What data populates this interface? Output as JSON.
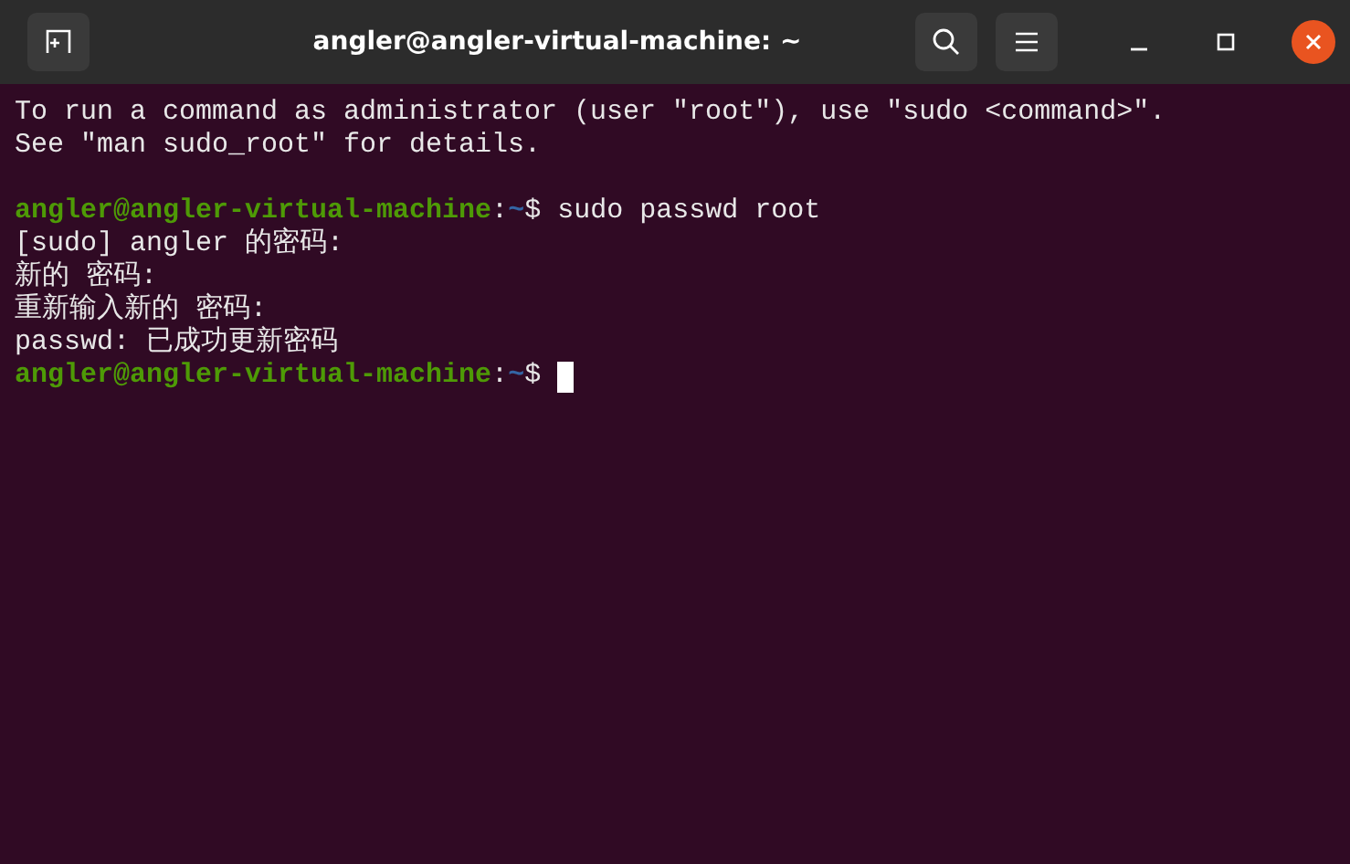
{
  "window": {
    "title": "angler@angler-virtual-machine: ~",
    "buttons": [
      {
        "kind": "new-tab"
      },
      {
        "kind": "search"
      },
      {
        "kind": "menu"
      },
      {
        "kind": "minimize"
      },
      {
        "kind": "maximize"
      },
      {
        "kind": "close"
      }
    ]
  },
  "terminal": {
    "lines": [
      {
        "kind": "output",
        "segments": [
          {
            "kind": "text",
            "text": "To run a command as administrator (user \"root\"), use \"sudo <command>\"."
          }
        ]
      },
      {
        "kind": "output",
        "segments": [
          {
            "kind": "text",
            "text": "See \"man sudo_root\" for details."
          }
        ]
      },
      {
        "kind": "blank"
      },
      {
        "kind": "output",
        "segments": [
          {
            "kind": "user",
            "text": "angler@angler-virtual-machine"
          },
          {
            "kind": "text",
            "text": ":"
          },
          {
            "kind": "path",
            "text": "~"
          },
          {
            "kind": "text",
            "text": "$ sudo passwd root"
          }
        ]
      },
      {
        "kind": "output",
        "segments": [
          {
            "kind": "text",
            "text": "[sudo] angler 的密码:"
          }
        ]
      },
      {
        "kind": "output",
        "segments": [
          {
            "kind": "text",
            "text": "新的 密码:"
          }
        ]
      },
      {
        "kind": "output",
        "segments": [
          {
            "kind": "text",
            "text": "重新输入新的 密码:"
          }
        ]
      },
      {
        "kind": "output",
        "segments": [
          {
            "kind": "text",
            "text": "passwd: 已成功更新密码"
          }
        ]
      },
      {
        "kind": "output",
        "segments": [
          {
            "kind": "user",
            "text": "angler@angler-virtual-machine"
          },
          {
            "kind": "text",
            "text": ":"
          },
          {
            "kind": "path",
            "text": "~"
          },
          {
            "kind": "text",
            "text": "$ "
          },
          {
            "kind": "cursor"
          }
        ]
      }
    ]
  }
}
